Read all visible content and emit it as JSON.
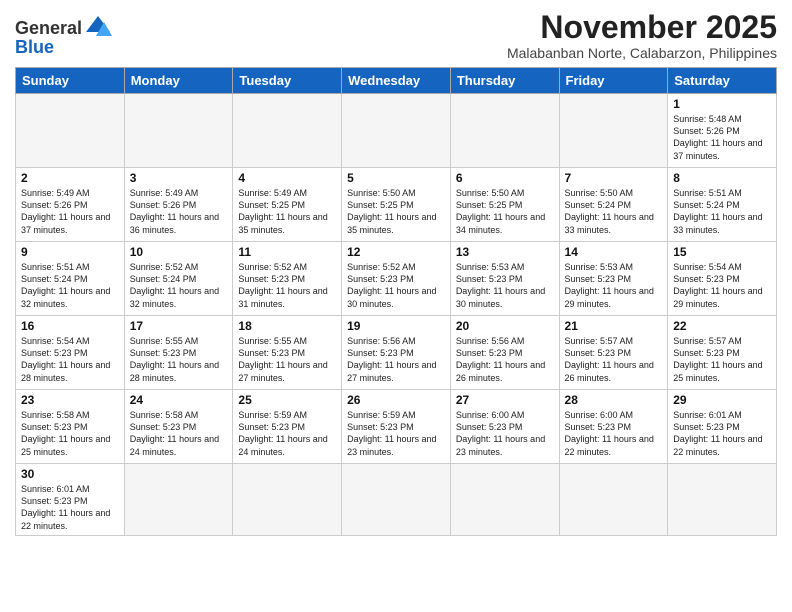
{
  "logo": {
    "general": "General",
    "blue": "Blue"
  },
  "header": {
    "month": "November 2025",
    "location": "Malabanban Norte, Calabarzon, Philippines"
  },
  "weekdays": [
    "Sunday",
    "Monday",
    "Tuesday",
    "Wednesday",
    "Thursday",
    "Friday",
    "Saturday"
  ],
  "weeks": [
    [
      {
        "day": "",
        "info": ""
      },
      {
        "day": "",
        "info": ""
      },
      {
        "day": "",
        "info": ""
      },
      {
        "day": "",
        "info": ""
      },
      {
        "day": "",
        "info": ""
      },
      {
        "day": "",
        "info": ""
      },
      {
        "day": "1",
        "info": "Sunrise: 5:48 AM\nSunset: 5:26 PM\nDaylight: 11 hours\nand 37 minutes."
      }
    ],
    [
      {
        "day": "2",
        "info": "Sunrise: 5:49 AM\nSunset: 5:26 PM\nDaylight: 11 hours\nand 37 minutes."
      },
      {
        "day": "3",
        "info": "Sunrise: 5:49 AM\nSunset: 5:26 PM\nDaylight: 11 hours\nand 36 minutes."
      },
      {
        "day": "4",
        "info": "Sunrise: 5:49 AM\nSunset: 5:25 PM\nDaylight: 11 hours\nand 35 minutes."
      },
      {
        "day": "5",
        "info": "Sunrise: 5:50 AM\nSunset: 5:25 PM\nDaylight: 11 hours\nand 35 minutes."
      },
      {
        "day": "6",
        "info": "Sunrise: 5:50 AM\nSunset: 5:25 PM\nDaylight: 11 hours\nand 34 minutes."
      },
      {
        "day": "7",
        "info": "Sunrise: 5:50 AM\nSunset: 5:24 PM\nDaylight: 11 hours\nand 33 minutes."
      },
      {
        "day": "8",
        "info": "Sunrise: 5:51 AM\nSunset: 5:24 PM\nDaylight: 11 hours\nand 33 minutes."
      }
    ],
    [
      {
        "day": "9",
        "info": "Sunrise: 5:51 AM\nSunset: 5:24 PM\nDaylight: 11 hours\nand 32 minutes."
      },
      {
        "day": "10",
        "info": "Sunrise: 5:52 AM\nSunset: 5:24 PM\nDaylight: 11 hours\nand 32 minutes."
      },
      {
        "day": "11",
        "info": "Sunrise: 5:52 AM\nSunset: 5:23 PM\nDaylight: 11 hours\nand 31 minutes."
      },
      {
        "day": "12",
        "info": "Sunrise: 5:52 AM\nSunset: 5:23 PM\nDaylight: 11 hours\nand 30 minutes."
      },
      {
        "day": "13",
        "info": "Sunrise: 5:53 AM\nSunset: 5:23 PM\nDaylight: 11 hours\nand 30 minutes."
      },
      {
        "day": "14",
        "info": "Sunrise: 5:53 AM\nSunset: 5:23 PM\nDaylight: 11 hours\nand 29 minutes."
      },
      {
        "day": "15",
        "info": "Sunrise: 5:54 AM\nSunset: 5:23 PM\nDaylight: 11 hours\nand 29 minutes."
      }
    ],
    [
      {
        "day": "16",
        "info": "Sunrise: 5:54 AM\nSunset: 5:23 PM\nDaylight: 11 hours\nand 28 minutes."
      },
      {
        "day": "17",
        "info": "Sunrise: 5:55 AM\nSunset: 5:23 PM\nDaylight: 11 hours\nand 28 minutes."
      },
      {
        "day": "18",
        "info": "Sunrise: 5:55 AM\nSunset: 5:23 PM\nDaylight: 11 hours\nand 27 minutes."
      },
      {
        "day": "19",
        "info": "Sunrise: 5:56 AM\nSunset: 5:23 PM\nDaylight: 11 hours\nand 27 minutes."
      },
      {
        "day": "20",
        "info": "Sunrise: 5:56 AM\nSunset: 5:23 PM\nDaylight: 11 hours\nand 26 minutes."
      },
      {
        "day": "21",
        "info": "Sunrise: 5:57 AM\nSunset: 5:23 PM\nDaylight: 11 hours\nand 26 minutes."
      },
      {
        "day": "22",
        "info": "Sunrise: 5:57 AM\nSunset: 5:23 PM\nDaylight: 11 hours\nand 25 minutes."
      }
    ],
    [
      {
        "day": "23",
        "info": "Sunrise: 5:58 AM\nSunset: 5:23 PM\nDaylight: 11 hours\nand 25 minutes."
      },
      {
        "day": "24",
        "info": "Sunrise: 5:58 AM\nSunset: 5:23 PM\nDaylight: 11 hours\nand 24 minutes."
      },
      {
        "day": "25",
        "info": "Sunrise: 5:59 AM\nSunset: 5:23 PM\nDaylight: 11 hours\nand 24 minutes."
      },
      {
        "day": "26",
        "info": "Sunrise: 5:59 AM\nSunset: 5:23 PM\nDaylight: 11 hours\nand 23 minutes."
      },
      {
        "day": "27",
        "info": "Sunrise: 6:00 AM\nSunset: 5:23 PM\nDaylight: 11 hours\nand 23 minutes."
      },
      {
        "day": "28",
        "info": "Sunrise: 6:00 AM\nSunset: 5:23 PM\nDaylight: 11 hours\nand 22 minutes."
      },
      {
        "day": "29",
        "info": "Sunrise: 6:01 AM\nSunset: 5:23 PM\nDaylight: 11 hours\nand 22 minutes."
      }
    ],
    [
      {
        "day": "30",
        "info": "Sunrise: 6:01 AM\nSunset: 5:23 PM\nDaylight: 11 hours\nand 22 minutes."
      },
      {
        "day": "",
        "info": ""
      },
      {
        "day": "",
        "info": ""
      },
      {
        "day": "",
        "info": ""
      },
      {
        "day": "",
        "info": ""
      },
      {
        "day": "",
        "info": ""
      },
      {
        "day": "",
        "info": ""
      }
    ]
  ]
}
